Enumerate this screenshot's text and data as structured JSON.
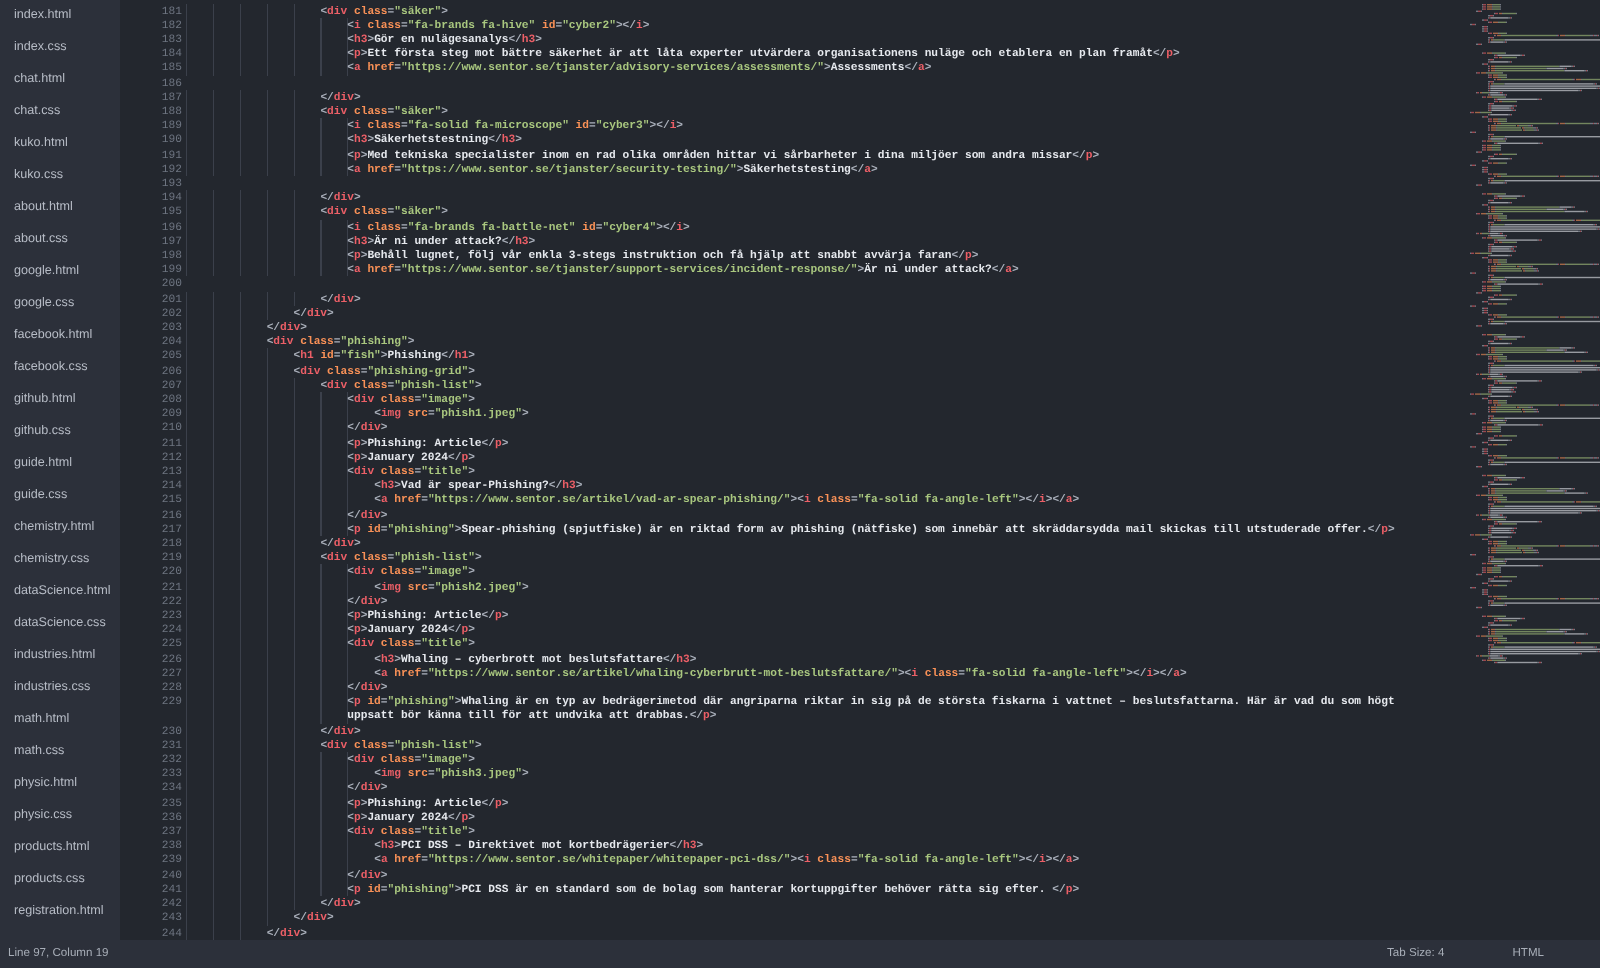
{
  "sidebar": {
    "files": [
      {
        "name": "index.html"
      },
      {
        "name": "index.css"
      },
      {
        "name": "chat.html"
      },
      {
        "name": "chat.css"
      },
      {
        "name": "kuko.html"
      },
      {
        "name": "kuko.css"
      },
      {
        "name": "about.html"
      },
      {
        "name": "about.css"
      },
      {
        "name": "google.html"
      },
      {
        "name": "google.css"
      },
      {
        "name": "facebook.html"
      },
      {
        "name": "facebook.css"
      },
      {
        "name": "github.html"
      },
      {
        "name": "github.css"
      },
      {
        "name": "guide.html"
      },
      {
        "name": "guide.css"
      },
      {
        "name": "chemistry.html"
      },
      {
        "name": "chemistry.css"
      },
      {
        "name": "dataScience.html"
      },
      {
        "name": "dataScience.css"
      },
      {
        "name": "industries.html"
      },
      {
        "name": "industries.css"
      },
      {
        "name": "math.html"
      },
      {
        "name": "math.css"
      },
      {
        "name": "physic.html"
      },
      {
        "name": "physic.css"
      },
      {
        "name": "products.html"
      },
      {
        "name": "products.css"
      },
      {
        "name": "registration.html"
      }
    ]
  },
  "editor": {
    "lines": [
      {
        "number": "181",
        "text": "\t\t\t\t\t<div class=\"säker\">"
      },
      {
        "number": "182",
        "text": "\t\t\t\t\t\t<i class=\"fa-brands fa-hive\" id=\"cyber2\"></i>"
      },
      {
        "number": "183",
        "text": "\t\t\t\t\t\t<h3>Gör en nulägesanalys</h3>"
      },
      {
        "number": "184",
        "text": "\t\t\t\t\t\t<p>Ett första steg mot bättre säkerhet är att låta experter utvärdera organisationens nuläge och etablera en plan framåt</p>"
      },
      {
        "number": "185",
        "text": "\t\t\t\t\t\t<a href=\"https://www.sentor.se/tjanster/advisory-services/assessments/\">Assessments</a>"
      },
      {
        "number": "186"
      },
      {
        "number": "187",
        "text": "\t\t\t\t\t</div>"
      },
      {
        "number": "188",
        "text": "\t\t\t\t\t<div class=\"säker\">"
      },
      {
        "number": "189",
        "text": "\t\t\t\t\t\t<i class=\"fa-solid fa-microscope\" id=\"cyber3\"></i>"
      },
      {
        "number": "190",
        "text": "\t\t\t\t\t\t<h3>Säkerhetstestning</h3>"
      },
      {
        "number": "191",
        "text": "\t\t\t\t\t\t<p>Med tekniska specialister inom en rad olika områden hittar vi sårbarheter i dina miljöer som andra missar</p>"
      },
      {
        "number": "192",
        "text": "\t\t\t\t\t\t<a href=\"https://www.sentor.se/tjanster/security-testing/\">Säkerhetstesting</a>"
      },
      {
        "number": "193"
      },
      {
        "number": "194",
        "text": "\t\t\t\t\t</div>"
      },
      {
        "number": "195",
        "text": "\t\t\t\t\t<div class=\"säker\">"
      },
      {
        "number": "196",
        "text": "\t\t\t\t\t\t<i class=\"fa-brands fa-battle-net\" id=\"cyber4\"></i>"
      },
      {
        "number": "197",
        "text": "\t\t\t\t\t\t<h3>Är ni under attack?</h3>"
      },
      {
        "number": "198",
        "text": "\t\t\t\t\t\t<p>Behåll lugnet, följ vår enkla 3-stegs instruktion och få hjälp att snabbt avvärja faran</p>"
      },
      {
        "number": "199",
        "text": "\t\t\t\t\t\t<a href=\"https://www.sentor.se/tjanster/support-services/incident-response/\">Är ni under attack?</a>"
      },
      {
        "number": "200"
      },
      {
        "number": "201",
        "text": "\t\t\t\t\t</div>"
      },
      {
        "number": "202",
        "text": "\t\t\t\t</div>"
      },
      {
        "number": "203",
        "text": "\t\t\t</div>"
      },
      {
        "number": "204",
        "text": "\t\t\t<div class=\"phishing\">"
      },
      {
        "number": "205",
        "text": "\t\t\t\t<h1 id=\"fish\">Phishing</h1>"
      },
      {
        "number": "206",
        "text": "\t\t\t\t<div class=\"phishing-grid\">"
      },
      {
        "number": "207",
        "text": "\t\t\t\t\t<div class=\"phish-list\">"
      },
      {
        "number": "208",
        "text": "\t\t\t\t\t\t<div class=\"image\">"
      },
      {
        "number": "209",
        "text": "\t\t\t\t\t\t\t<img src=\"phish1.jpeg\">"
      },
      {
        "number": "210",
        "text": "\t\t\t\t\t\t</div>"
      },
      {
        "number": "211",
        "text": "\t\t\t\t\t\t<p>Phishing: Article</p>"
      },
      {
        "number": "212",
        "text": "\t\t\t\t\t\t<p>January 2024</p>"
      },
      {
        "number": "213",
        "text": "\t\t\t\t\t\t<div class=\"title\">"
      },
      {
        "number": "214",
        "text": "\t\t\t\t\t\t\t<h3>Vad är spear-Phishing?</h3>"
      },
      {
        "number": "215",
        "text": "\t\t\t\t\t\t\t<a href=\"https://www.sentor.se/artikel/vad-ar-spear-phishing/\"><i class=\"fa-solid fa-angle-left\"></i></a>"
      },
      {
        "number": "216",
        "text": "\t\t\t\t\t\t</div>"
      },
      {
        "number": "217",
        "text": "\t\t\t\t\t\t<p id=\"phishing\">Spear-phishing (spjutfiske) är en riktad form av phishing (nätfiske) som innebär att skräddarsydda mail skickas till utstuderade offer.</p>"
      },
      {
        "number": "218",
        "text": "\t\t\t\t\t</div>"
      },
      {
        "number": "219",
        "text": "\t\t\t\t\t<div class=\"phish-list\">"
      },
      {
        "number": "220",
        "text": "\t\t\t\t\t\t<div class=\"image\">"
      },
      {
        "number": "221",
        "text": "\t\t\t\t\t\t\t<img src=\"phish2.jpeg\">"
      },
      {
        "number": "222",
        "text": "\t\t\t\t\t\t</div>"
      },
      {
        "number": "223",
        "text": "\t\t\t\t\t\t<p>Phishing: Article</p>"
      },
      {
        "number": "224",
        "text": "\t\t\t\t\t\t<p>January 2024</p>"
      },
      {
        "number": "225",
        "text": "\t\t\t\t\t\t<div class=\"title\">"
      },
      {
        "number": "226",
        "text": "\t\t\t\t\t\t\t<h3>Whaling – cyberbrott mot beslutsfattare</h3>"
      },
      {
        "number": "227",
        "text": "\t\t\t\t\t\t\t<a href=\"https://www.sentor.se/artikel/whaling-cyberbrutt-mot-beslutsfattare/\"><i class=\"fa-solid fa-angle-left\"></i></a>"
      },
      {
        "number": "228",
        "text": "\t\t\t\t\t\t</div>"
      },
      {
        "number": "229",
        "text": "\t\t\t\t\t\t<p id=\"phishing\">Whaling är en typ av bedrägerimetod där angriparna riktar in sig på de största fiskarna i vattnet – beslutsfattarna. Här är vad du som högt uppsatt bör känna till för att undvika att drabbas.</p>"
      },
      {
        "number": "230",
        "text": "\t\t\t\t\t</div>"
      },
      {
        "number": "231",
        "text": "\t\t\t\t\t<div class=\"phish-list\">"
      },
      {
        "number": "232",
        "text": "\t\t\t\t\t\t<div class=\"image\">"
      },
      {
        "number": "233",
        "text": "\t\t\t\t\t\t\t<img src=\"phish3.jpeg\">"
      },
      {
        "number": "234",
        "text": "\t\t\t\t\t\t</div>"
      },
      {
        "number": "235",
        "text": "\t\t\t\t\t\t<p>Phishing: Article</p>"
      },
      {
        "number": "236",
        "text": "\t\t\t\t\t\t<p>January 2024</p>"
      },
      {
        "number": "237",
        "text": "\t\t\t\t\t\t<div class=\"title\">"
      },
      {
        "number": "238",
        "text": "\t\t\t\t\t\t\t<h3>PCI DSS – Direktivet mot kortbedrägerier</h3>"
      },
      {
        "number": "239",
        "text": "\t\t\t\t\t\t\t<a href=\"https://www.sentor.se/whitepaper/whitepaper-pci-dss/\"><i class=\"fa-solid fa-angle-left\"></i></a>"
      },
      {
        "number": "240",
        "text": "\t\t\t\t\t\t</div>"
      },
      {
        "number": "241",
        "text": "\t\t\t\t\t\t<p id=\"phishing\">PCI DSS är en standard som de bolag som hanterar kortuppgifter behöver rätta sig efter. </p>"
      },
      {
        "number": "242",
        "text": "\t\t\t\t\t</div>"
      },
      {
        "number": "243",
        "text": "\t\t\t\t</div>"
      },
      {
        "number": "244",
        "text": "\t\t\t</div>"
      }
    ]
  },
  "status_bar": {
    "position": "Line 97, Column 19",
    "tab_size": "Tab Size: 4",
    "syntax": "HTML"
  }
}
